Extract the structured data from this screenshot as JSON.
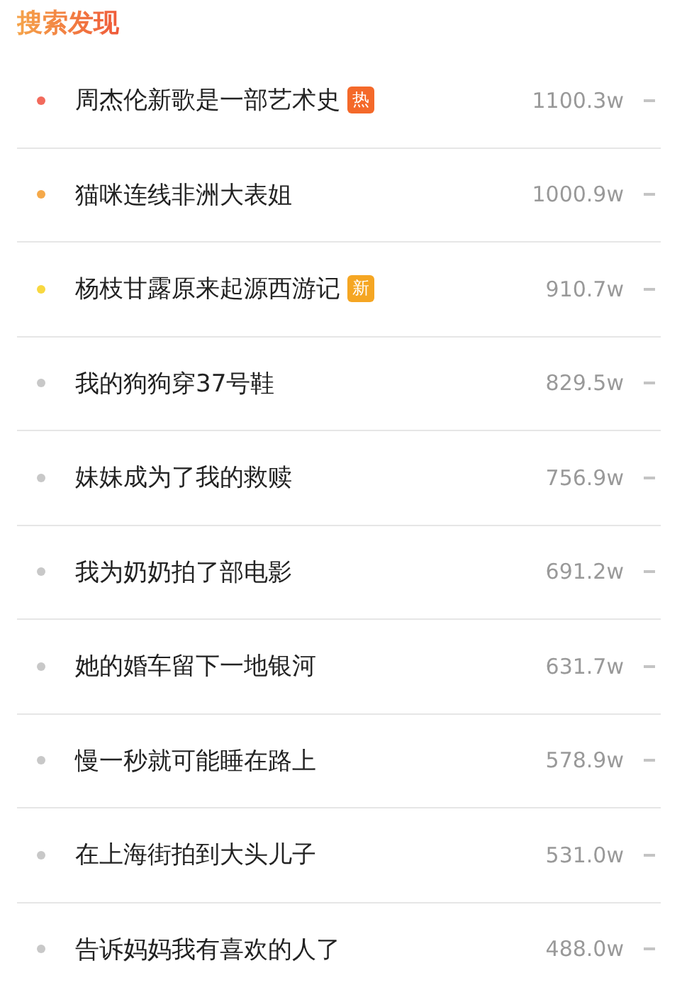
{
  "header": {
    "title": "搜索发现"
  },
  "items": [
    {
      "title": "周杰伦新歌是一部艺术史",
      "badge": {
        "text": "热",
        "kind": "hot"
      },
      "count": "1100.3w",
      "color": "#f26a5c"
    },
    {
      "title": "猫咪连线非洲大表姐",
      "count": "1000.9w",
      "color": "#f5a94a"
    },
    {
      "title": "杨枝甘露原来起源西游记",
      "badge": {
        "text": "新",
        "kind": "new"
      },
      "count": "910.7w",
      "color": "#f8d840"
    },
    {
      "title": "我的狗狗穿37号鞋",
      "count": "829.5w",
      "color": "#c8c8c8"
    },
    {
      "title": "妹妹成为了我的救赎",
      "count": "756.9w",
      "color": "#c8c8c8"
    },
    {
      "title": "我为奶奶拍了部电影",
      "count": "691.2w",
      "color": "#c8c8c8"
    },
    {
      "title": "她的婚车留下一地银河",
      "count": "631.7w",
      "color": "#c8c8c8"
    },
    {
      "title": "慢一秒就可能睡在路上",
      "count": "578.9w",
      "color": "#c8c8c8"
    },
    {
      "title": "在上海街拍到大头儿子",
      "count": "531.0w",
      "color": "#c8c8c8"
    },
    {
      "title": "告诉妈妈我有喜欢的人了",
      "count": "488.0w",
      "color": "#c8c8c8"
    }
  ]
}
